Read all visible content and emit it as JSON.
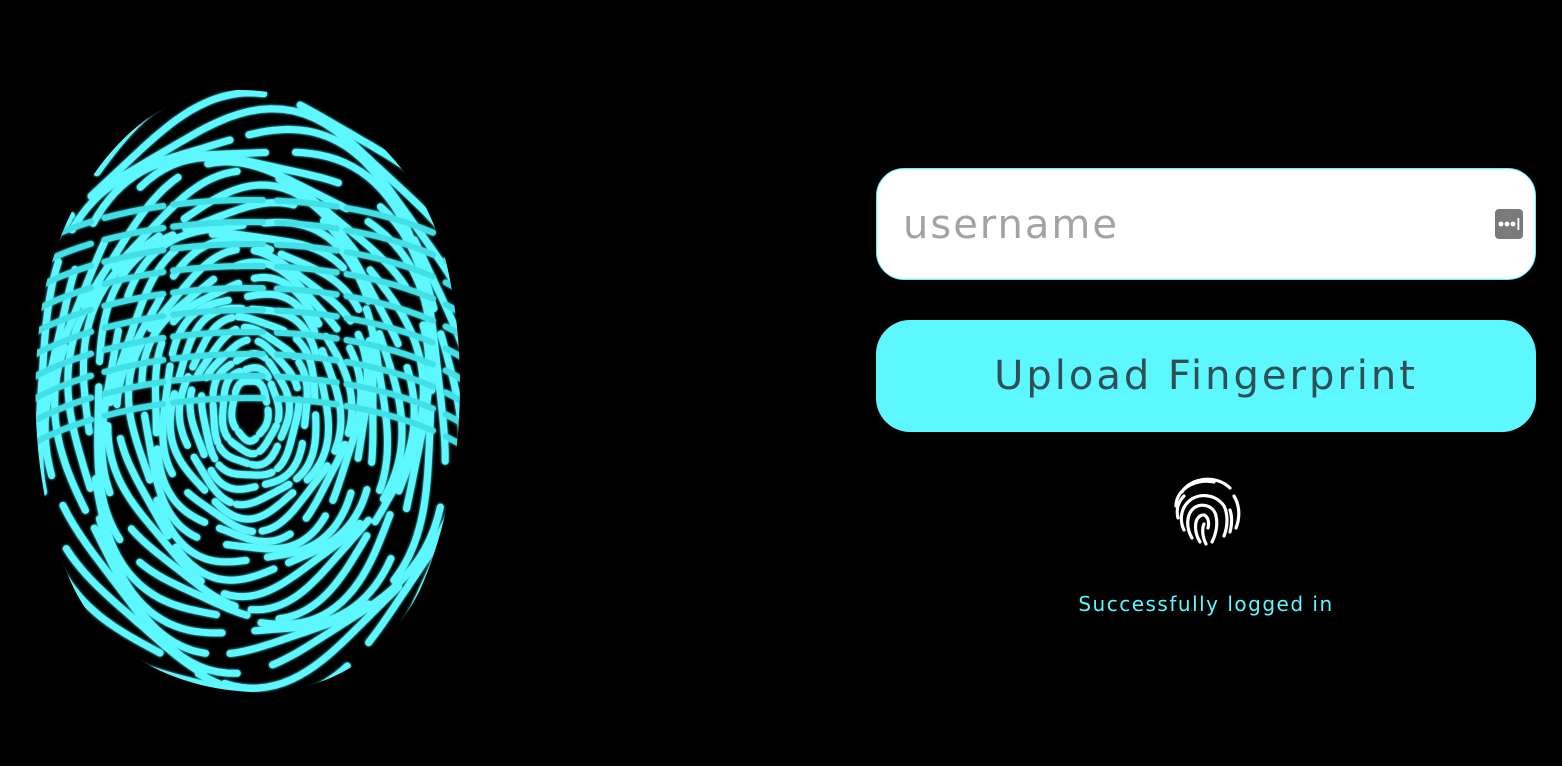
{
  "colors": {
    "background": "#000000",
    "accent": "#5cf7ff",
    "input_background": "#ffffff",
    "placeholder": "#a3a3a3",
    "button_text": "#2f4f55"
  },
  "hero": {
    "icon": "fingerprint-illustration"
  },
  "login_form": {
    "username": {
      "value": "",
      "placeholder": "username",
      "trailing_icon": "password-manager-icon"
    },
    "upload_button_label": "Upload Fingerprint",
    "fingerprint_icon": "fingerprint-icon",
    "status_message": "Successfully logged in"
  }
}
